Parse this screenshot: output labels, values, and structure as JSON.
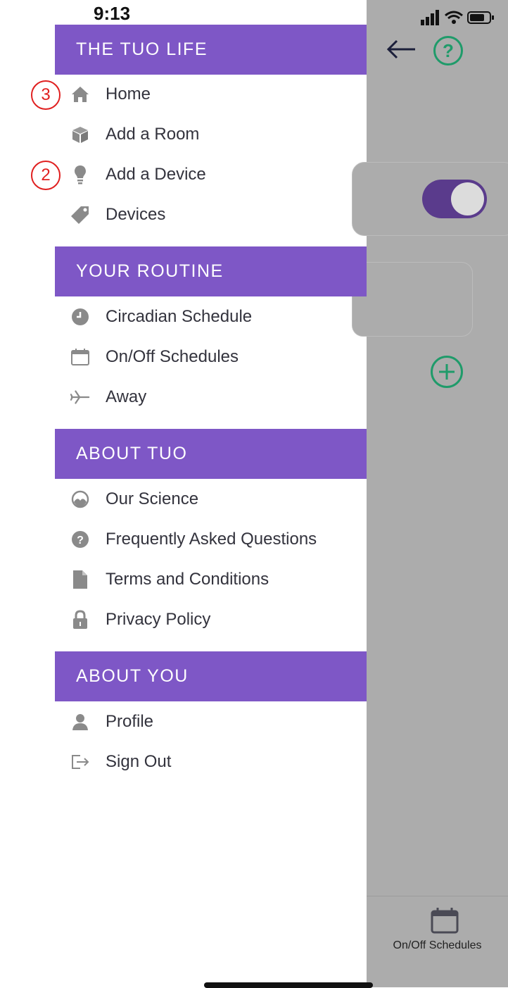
{
  "status_bar": {
    "time": "9:13"
  },
  "drawer": {
    "sections": [
      {
        "title": "THE TUO LIFE",
        "items": [
          {
            "label": "Home",
            "icon": "home-icon"
          },
          {
            "label": "Add a Room",
            "icon": "box-icon"
          },
          {
            "label": "Add a Device",
            "icon": "lightbulb-icon"
          },
          {
            "label": "Devices",
            "icon": "tag-icon"
          }
        ]
      },
      {
        "title": "YOUR ROUTINE",
        "items": [
          {
            "label": "Circadian Schedule",
            "icon": "clock-icon"
          },
          {
            "label": "On/Off Schedules",
            "icon": "calendar-icon"
          },
          {
            "label": "Away",
            "icon": "airplane-icon"
          }
        ]
      },
      {
        "title": "ABOUT TUO",
        "items": [
          {
            "label": "Our Science",
            "icon": "science-icon"
          },
          {
            "label": "Frequently Asked Questions",
            "icon": "question-icon"
          },
          {
            "label": "Terms and Conditions",
            "icon": "document-icon"
          },
          {
            "label": "Privacy Policy",
            "icon": "lock-icon"
          }
        ]
      },
      {
        "title": "ABOUT YOU",
        "items": [
          {
            "label": "Profile",
            "icon": "user-icon"
          },
          {
            "label": "Sign Out",
            "icon": "sign-out-icon"
          }
        ]
      }
    ]
  },
  "background": {
    "help_label": "?",
    "tab_label": "On/Off Schedules"
  },
  "annotations": {
    "home_marker": "3",
    "add_device_marker": "2"
  },
  "colors": {
    "accent": "#7e57c6",
    "green": "#1f9b6a",
    "overlay": "#acacac"
  }
}
